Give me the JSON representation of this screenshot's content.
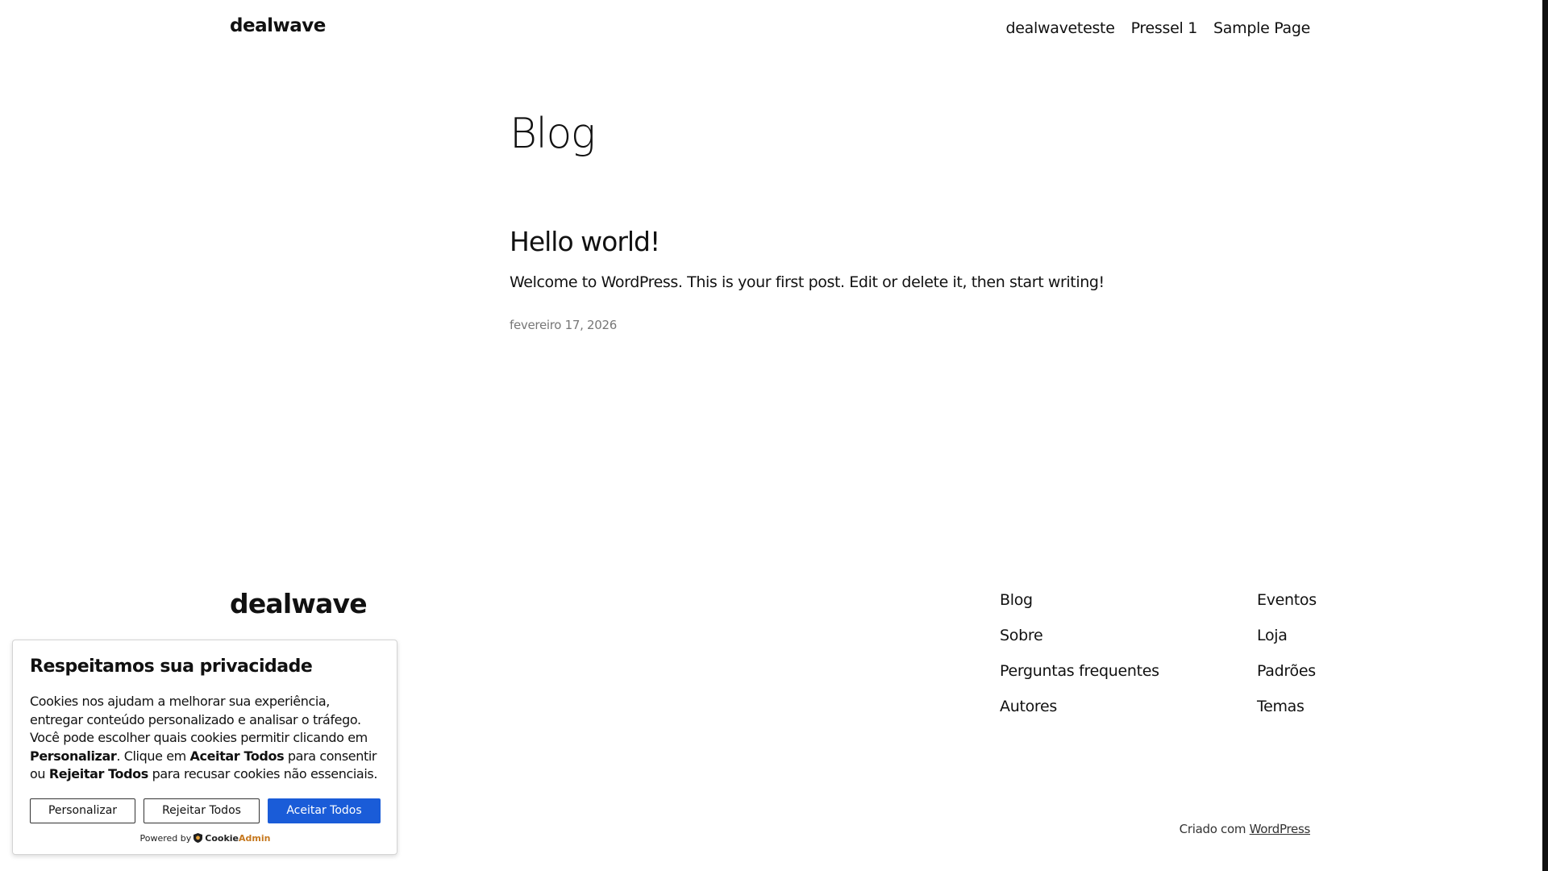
{
  "header": {
    "site_title": "dealwave",
    "nav": [
      "dealwaveteste",
      "Pressel 1",
      "Sample Page"
    ]
  },
  "main": {
    "page_title": "Blog",
    "post": {
      "title": "Hello world!",
      "excerpt": "Welcome to WordPress. This is your first post. Edit or delete it, then start writing!",
      "date": "fevereiro 17, 2026"
    }
  },
  "footer": {
    "site_title": "dealwave",
    "col1": [
      "Blog",
      "Sobre",
      "Perguntas frequentes",
      "Autores"
    ],
    "col2": [
      "Eventos",
      "Loja",
      "Padrões",
      "Temas"
    ],
    "credit_prefix": "Criado com",
    "credit_link": "WordPress"
  },
  "cookie": {
    "heading": "Respeitamos sua privacidade",
    "text_1": "Cookies nos ajudam a melhorar sua experiência, entregar conteúdo personalizado e analisar o tráfego. Você pode escolher quais cookies permitir clicando em ",
    "text_bold_1": "Personalizar",
    "text_2": ". Clique em ",
    "text_bold_2": "Aceitar Todos",
    "text_3": " para consentir ou ",
    "text_bold_3": "Rejeitar Todos",
    "text_4": " para recusar cookies não essenciais.",
    "btn_personalize": "Personalizar",
    "btn_reject": "Rejeitar Todos",
    "btn_accept": "Aceitar Todos",
    "powered_by": "Powered by",
    "brand_1": "Cookie",
    "brand_2": "Admin",
    "accent_color": "#1a5cd8"
  }
}
